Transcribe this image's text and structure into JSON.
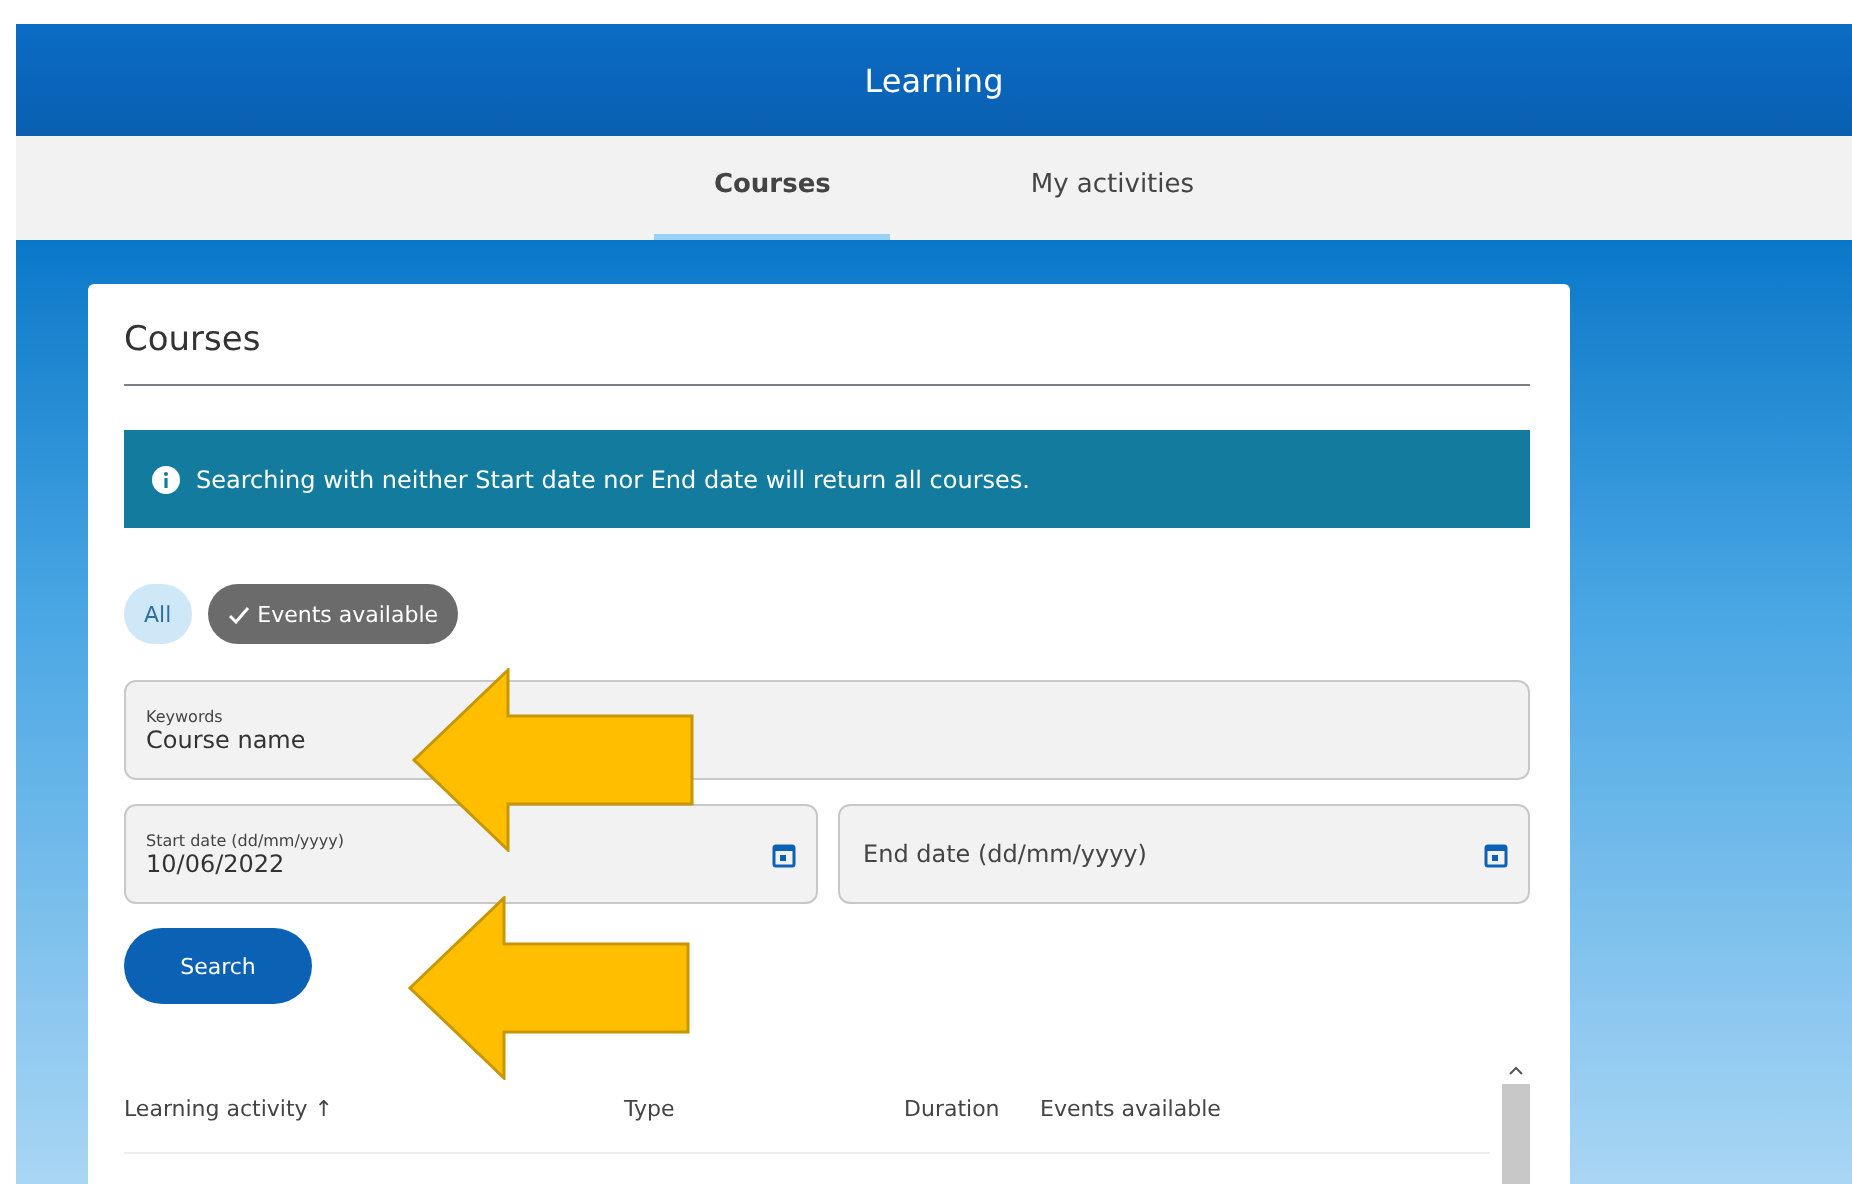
{
  "header": {
    "title": "Learning"
  },
  "tabs": [
    {
      "label": "Courses",
      "selected": true
    },
    {
      "label": "My activities",
      "selected": false
    }
  ],
  "card": {
    "title": "Courses",
    "info": "Searching with neither Start date nor End date will return all courses.",
    "chips": [
      {
        "label": "All",
        "selected": false
      },
      {
        "label": "Events available",
        "selected": true
      }
    ],
    "keywords": {
      "label": "Keywords",
      "value": "Course name"
    },
    "start_date": {
      "label": "Start date (dd/mm/yyyy)",
      "value": "10/06/2022"
    },
    "end_date": {
      "placeholder": "End date (dd/mm/yyyy)"
    },
    "search_button": "Search",
    "table": {
      "columns": [
        {
          "label": "Learning activity",
          "sort": "↑"
        },
        {
          "label": "Type"
        },
        {
          "label": "Duration"
        },
        {
          "label": "Events available"
        }
      ]
    }
  }
}
